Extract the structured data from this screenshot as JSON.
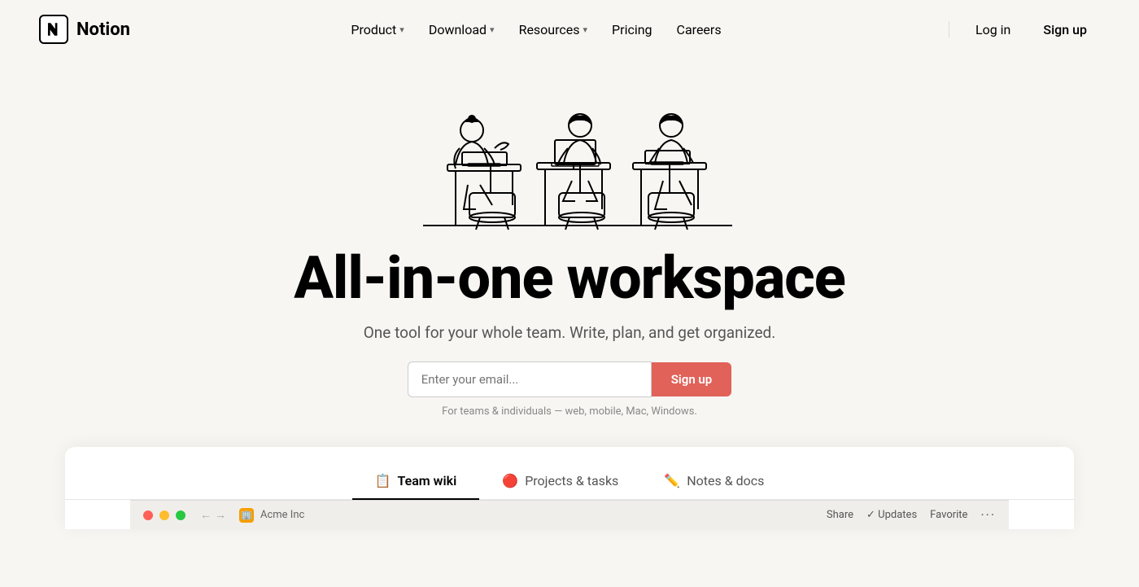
{
  "navbar": {
    "logo_icon": "N",
    "logo_text": "Notion",
    "nav_items": [
      {
        "label": "Product",
        "has_chevron": true,
        "id": "product"
      },
      {
        "label": "Download",
        "has_chevron": true,
        "id": "download"
      },
      {
        "label": "Resources",
        "has_chevron": true,
        "id": "resources"
      },
      {
        "label": "Pricing",
        "has_chevron": false,
        "id": "pricing"
      },
      {
        "label": "Careers",
        "has_chevron": false,
        "id": "careers"
      }
    ],
    "login_label": "Log in",
    "signup_label": "Sign up"
  },
  "hero": {
    "title": "All-in-one workspace",
    "subtitle": "One tool for your whole team. Write, plan, and get organized.",
    "email_placeholder": "Enter your email...",
    "signup_button": "Sign up",
    "disclaimer": "For teams & individuals — web, mobile, Mac, Windows."
  },
  "tabs": [
    {
      "icon": "📋",
      "label": "Team wiki",
      "active": true
    },
    {
      "icon": "🔴",
      "label": "Projects & tasks",
      "active": false
    },
    {
      "icon": "✏️",
      "label": "Notes & docs",
      "active": false
    }
  ],
  "browser_bar": {
    "favicon_emoji": "🏢",
    "page_title": "Acme Inc",
    "share_label": "Share",
    "updates_label": "Updates",
    "favorite_label": "Favorite"
  },
  "colors": {
    "signup_button_bg": "#e16259",
    "active_tab_border": "#000000"
  }
}
